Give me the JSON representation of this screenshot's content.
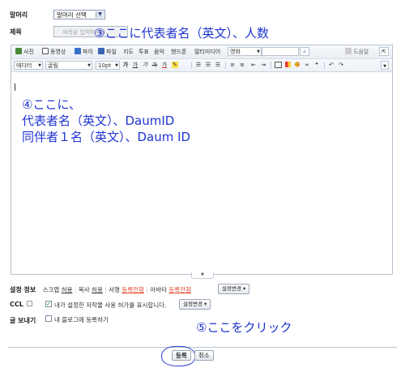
{
  "form": {
    "category_label": "말머리",
    "category_value": "말머리 선택",
    "title_label": "제목",
    "title_placeholder": "제목을 입력하세요"
  },
  "annotations": {
    "title_note": "③ここに代表者名（英文）、人数",
    "body_line1": "④ここに、",
    "body_line2": "代表者名（英文）、DaumID",
    "body_line3": "同伴者１名（英文）、Daum ID",
    "click_note": "⑤ここをクリック"
  },
  "toolbar1": {
    "photo": "사진",
    "video": "동영상",
    "file_pie": "파이",
    "file": "파일",
    "map": "지도",
    "vote": "투표",
    "music": "음악",
    "handphone": "핸드폰",
    "multimedia": "멀티미디어",
    "dict_select": "영화",
    "help": "도움말"
  },
  "toolbar2": {
    "editor_select": "에디터",
    "font_select": "굴림",
    "size_select": "10pt",
    "bold": "가",
    "underline": "가",
    "italic": "가",
    "strike": "가",
    "color": "가"
  },
  "settings": {
    "section_label": "설정 정보",
    "scrap": "스크랩",
    "scrap_value": "허용",
    "copy": "복사",
    "copy_value": "허용",
    "sign": "서명",
    "sign_value": "등록안함",
    "avatar": "아바타",
    "avatar_value": "등록안함",
    "change_button": "설정변경",
    "ccl_label": "CCL",
    "ccl_text": "내가 설정한 저작물 사용 허가를 표시합니다.",
    "ccl_change": "설정변경",
    "send_label": "글 보내기",
    "send_text": "내 블로그에 등록하기"
  },
  "actions": {
    "submit": "등록",
    "cancel": "취소"
  }
}
